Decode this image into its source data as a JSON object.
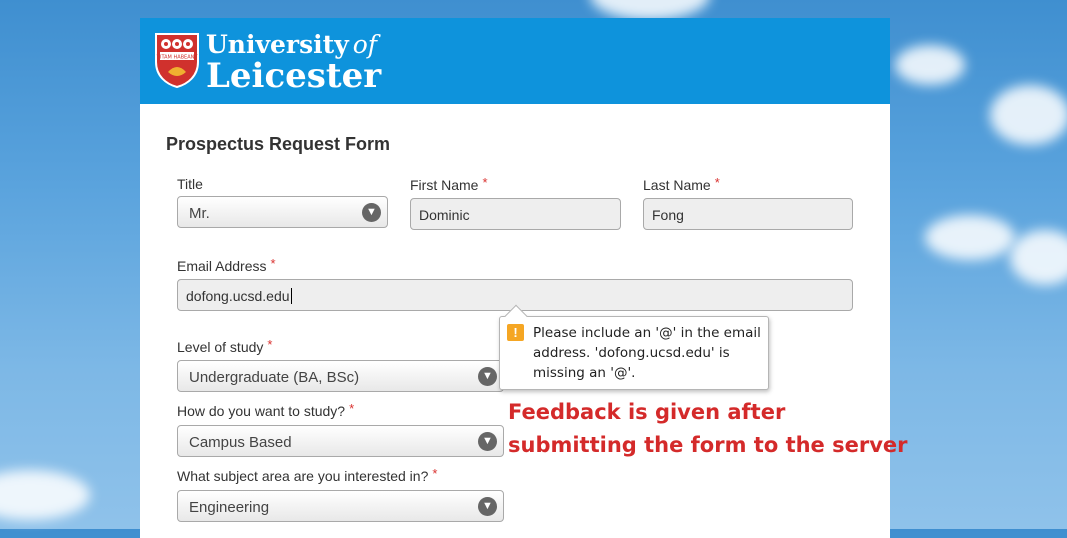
{
  "brand": {
    "line1": "University",
    "of": "of",
    "line2": "Leicester",
    "crest_motto": "VITAM HABEANT"
  },
  "form": {
    "title": "Prospectus Request Form",
    "required_mark": "*",
    "title_field": {
      "label": "Title",
      "value": "Mr."
    },
    "first_name": {
      "label": "First Name",
      "value": "Dominic"
    },
    "last_name": {
      "label": "Last Name",
      "value": "Fong"
    },
    "email": {
      "label": "Email Address",
      "value": "dofong.ucsd.edu"
    },
    "level": {
      "label": "Level of study",
      "value": "Undergraduate (BA, BSc)"
    },
    "mode": {
      "label": "How do you want to study?",
      "value": "Campus Based"
    },
    "subject": {
      "label": "What subject area are you interested in?",
      "value": "Engineering"
    }
  },
  "validation": {
    "icon": "warning-icon",
    "message": "Please include an '@' in the email address. 'dofong.ucsd.edu' is missing an '@'."
  },
  "annotation": {
    "line1": "Feedback is given after",
    "line2": "submitting the form to the server"
  },
  "colors": {
    "header": "#0e93dc",
    "required": "#d9312f",
    "annotation": "#d42a2a",
    "warning": "#f5a623"
  }
}
